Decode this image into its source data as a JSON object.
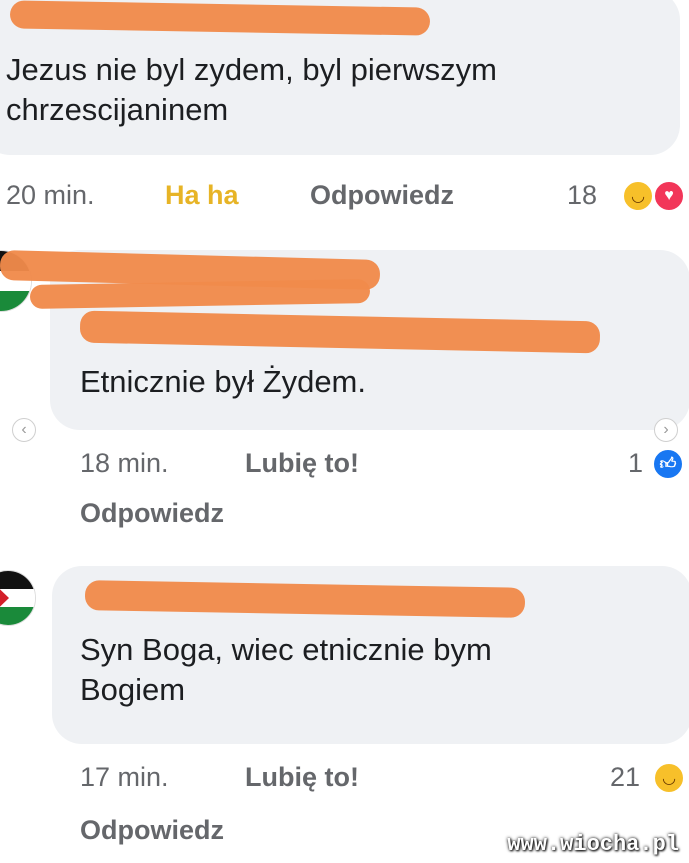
{
  "comments": [
    {
      "text": "Jezus nie byl zydem, byl pierwszym\nchrzescijaninem",
      "time": "20 min.",
      "reaction_label": "Ha ha",
      "reply_label": "Odpowiedz",
      "reaction_count": "18",
      "reaction_icons": [
        "haha-icon",
        "love-icon"
      ]
    },
    {
      "text": "Etnicznie był Żydem.",
      "time": "18 min.",
      "reaction_label": "Lubię to!",
      "reply_label": "Odpowiedz",
      "reaction_count": "1",
      "reaction_icons": [
        "like-icon"
      ]
    },
    {
      "text": "Syn Boga, wiec etnicznie bym\nBogiem",
      "time": "17 min.",
      "reaction_label": "Lubię to!",
      "reply_label": "Odpowiedz",
      "reaction_count": "21",
      "reaction_icons": [
        "haha-icon"
      ]
    }
  ],
  "watermark": "www.wiocha.pl",
  "colors": {
    "bubble": "#eff1f4",
    "scribble": "#f08a4b",
    "haha_label": "#e7b426",
    "meta": "#65676b"
  }
}
